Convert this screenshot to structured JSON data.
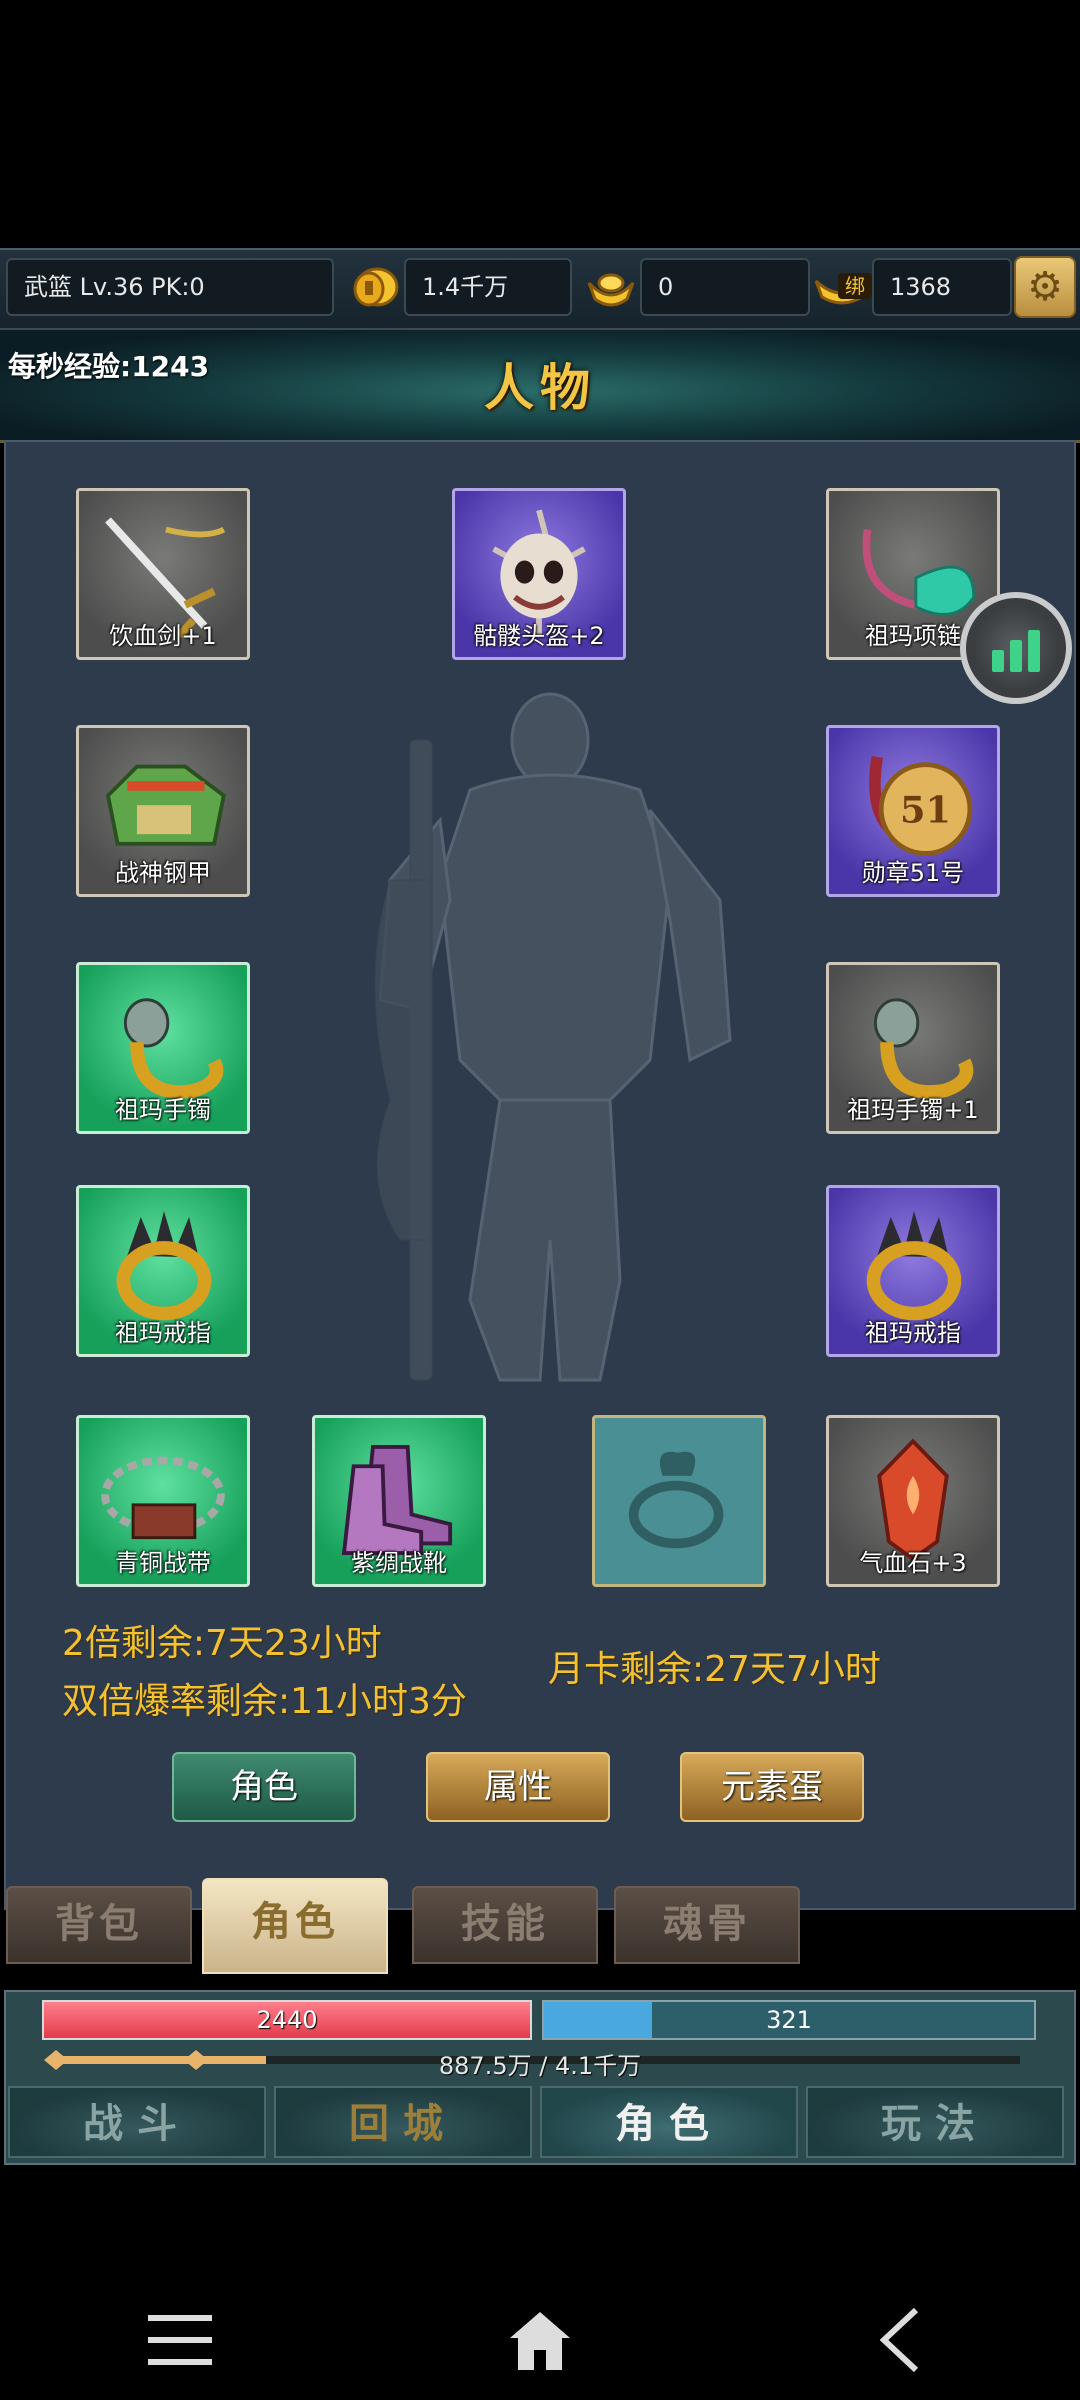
{
  "status_bar": {
    "player": "武篮  Lv.36 PK:0",
    "gold": "1.4千万",
    "ingots": "0",
    "bound_label": "绑",
    "bound_ingots": "1368"
  },
  "banner": {
    "title": "人物",
    "exp_per_sec": "每秒经验:1243"
  },
  "equipment": [
    {
      "name": "饮血剑+1",
      "rarity": "gray",
      "icon": "sword-icon"
    },
    {
      "name": "骷髅头盔+2",
      "rarity": "purple",
      "icon": "skull-helmet-icon"
    },
    {
      "name": "祖玛项链",
      "rarity": "gray",
      "icon": "necklace-icon"
    },
    {
      "name": "战神钢甲",
      "rarity": "gray",
      "icon": "armor-icon"
    },
    {
      "name": "勋章51号",
      "rarity": "purple",
      "icon": "medal-icon",
      "medal_number": "51"
    },
    {
      "name": "祖玛手镯",
      "rarity": "green",
      "icon": "bracelet-icon"
    },
    {
      "name": "祖玛手镯+1",
      "rarity": "gray",
      "icon": "bracelet-icon"
    },
    {
      "name": "祖玛戒指",
      "rarity": "green",
      "icon": "ring-icon"
    },
    {
      "name": "祖玛戒指",
      "rarity": "purple",
      "icon": "ring-icon"
    },
    {
      "name": "青铜战带",
      "rarity": "green",
      "icon": "belt-icon"
    },
    {
      "name": "紫绸战靴",
      "rarity": "green",
      "icon": "boots-icon"
    },
    {
      "name": "",
      "rarity": "empty",
      "icon": "empty-slot-icon"
    },
    {
      "name": "气血石+3",
      "rarity": "gray",
      "icon": "blood-stone-icon"
    }
  ],
  "buffs": {
    "double_exp": "2倍剩余:7天23小时",
    "double_drop": "双倍爆率剩余:11小时3分",
    "month_card": "月卡剩余:27天7小时"
  },
  "action_buttons": [
    "角色",
    "属性",
    "元素蛋"
  ],
  "tabs": [
    "背包",
    "角色",
    "技能",
    "魂骨"
  ],
  "active_tab": "角色",
  "hud": {
    "hp": "2440",
    "mp": "321",
    "mp_fraction": 0.22,
    "exp_text": "887.5万 / 4.1千万",
    "exp_fraction": 0.216
  },
  "nav": [
    "战斗",
    "回城",
    "角色",
    "玩法"
  ],
  "colors": {
    "accent_gold": "#f3c131",
    "panel": "#2d3b4d",
    "hp": "#e23c4b",
    "mp": "#4aa8e0"
  }
}
